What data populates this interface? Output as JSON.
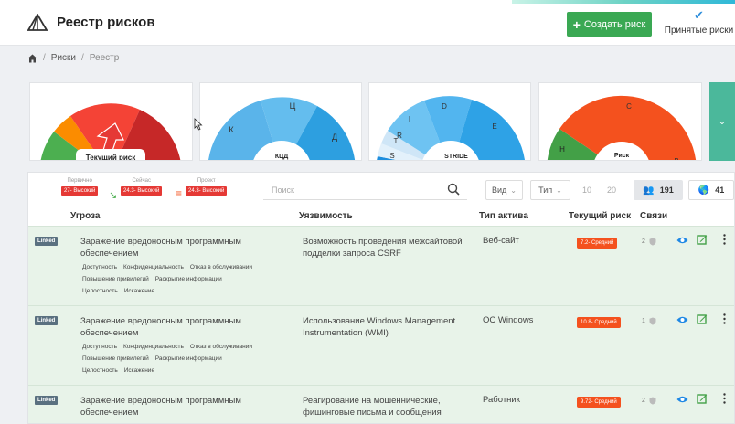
{
  "header": {
    "title": "Реестр рисков",
    "create_button": "Создать риск",
    "accepted_label": "Принятые риски"
  },
  "breadcrumb": {
    "items": [
      "Риски",
      "Реестр"
    ]
  },
  "gauges": [
    {
      "title": "Текущий риск",
      "segments": [
        "green",
        "orange",
        "red",
        "dark-red"
      ]
    },
    {
      "title": "КЦД",
      "labels": [
        "К",
        "Ц",
        "Д"
      ]
    },
    {
      "title": "STRIDE",
      "labels": [
        "S",
        "T",
        "R",
        "I",
        "D",
        "E"
      ]
    },
    {
      "title": "Риск",
      "labels": [
        "Н",
        "С",
        "В"
      ]
    }
  ],
  "summary": {
    "initial": {
      "label": "Первично",
      "value": "27- Высокий"
    },
    "now": {
      "label": "Сейчас",
      "value": "24.3- Высокий"
    },
    "project": {
      "label": "Проект",
      "value": "24.3- Высокий"
    }
  },
  "search": {
    "placeholder": "Поиск"
  },
  "filters": {
    "view": "Вид",
    "type": "Тип",
    "page_sizes": [
      "10",
      "20"
    ]
  },
  "counters": {
    "people": "191",
    "world": "41"
  },
  "columns": {
    "threat": "Угроза",
    "vulnerability": "Уязвимость",
    "asset_type": "Тип актива",
    "current_risk": "Текущий риск",
    "links": "Связи"
  },
  "rows": [
    {
      "badge": "Linked",
      "threat": "Заражение вредоносным программным обеспечением",
      "tags": [
        [
          "Доступность",
          "Конфиденциальность",
          "Отказ в обслуживании"
        ],
        [
          "Повышение привилегий",
          "Раскрытие информации"
        ],
        [
          "Целостность",
          "Искажение"
        ]
      ],
      "vulnerability": "Возможность проведения межсайтовой подделки запроса CSRF",
      "asset_type": "Веб-сайт",
      "risk": "7.2- Средний",
      "links": "2"
    },
    {
      "badge": "Linked",
      "threat": "Заражение вредоносным программным обеспечением",
      "tags": [
        [
          "Доступность",
          "Конфиденциальность",
          "Отказ в обслуживании"
        ],
        [
          "Повышение привилегий",
          "Раскрытие информации"
        ],
        [
          "Целостность",
          "Искажение"
        ]
      ],
      "vulnerability": "Использование Windows Management Instrumentation (WMI)",
      "asset_type": "ОС Windows",
      "risk": "10.8- Средний",
      "links": "1"
    },
    {
      "badge": "Linked",
      "threat": "Заражение вредоносным программным обеспечением",
      "tags": [],
      "vulnerability": "Реагирование на мошеннические, фишинговые письма и сообщения",
      "asset_type": "Работник",
      "risk": "9.72- Средний",
      "links": "2"
    }
  ]
}
